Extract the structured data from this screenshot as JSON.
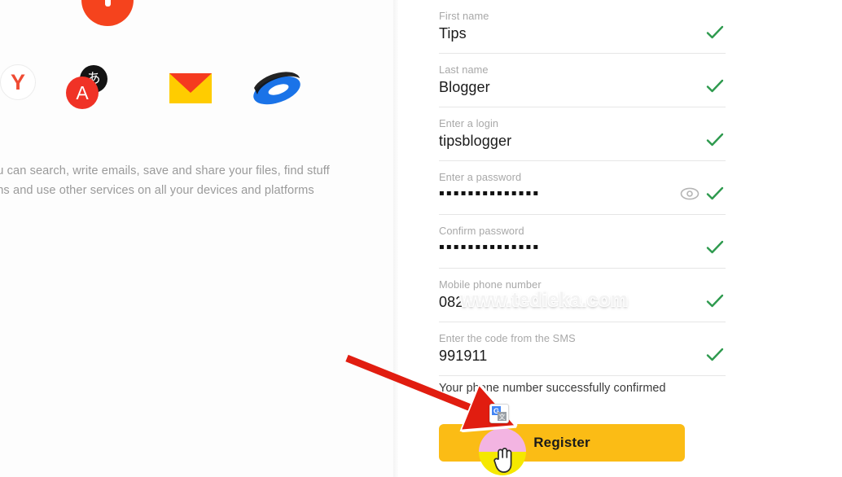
{
  "left_panel": {
    "service_icons": [
      {
        "name": "yandex-browser-icon",
        "glyph": "Y",
        "color": "#ef4b33"
      },
      {
        "name": "yandex-music-icon",
        "glyph": "",
        "color": "#f5431d"
      },
      {
        "name": "yandex-translate-icon",
        "glyph": "A",
        "glyph_secondary": "あ",
        "color": "#f03226"
      },
      {
        "name": "yandex-mail-icon",
        "glyph": "",
        "color": "#ffcc00"
      },
      {
        "name": "yandex-disk-icon",
        "glyph": "",
        "color": "#1a73e8"
      }
    ],
    "promo_line_1": "ou can search, write emails, save and share your files, find stuff",
    "promo_line_2": "ons and use other services on all your devices and platforms"
  },
  "form": {
    "fields": [
      {
        "label": "First name",
        "value": "Tips",
        "masked": false,
        "valid": true,
        "has_eye": false
      },
      {
        "label": "Last name",
        "value": "Blogger",
        "masked": false,
        "valid": true,
        "has_eye": false
      },
      {
        "label": "Enter a login",
        "value": "tipsblogger",
        "masked": false,
        "valid": true,
        "has_eye": false
      },
      {
        "label": "Enter a password",
        "value": "▪▪▪▪▪▪▪▪▪▪▪▪▪▪",
        "masked": true,
        "valid": true,
        "has_eye": true
      },
      {
        "label": "Confirm password",
        "value": "▪▪▪▪▪▪▪▪▪▪▪▪▪▪",
        "masked": true,
        "valid": true,
        "has_eye": false
      },
      {
        "label": "Mobile phone number",
        "value": "082",
        "masked": false,
        "valid": true,
        "has_eye": false
      },
      {
        "label": "Enter the code from the SMS",
        "value": "991911",
        "masked": false,
        "valid": true,
        "has_eye": false
      }
    ],
    "success_message": "Your phone number successfully confirmed",
    "register_label": "Register"
  },
  "overlay": {
    "watermark": "www.tedieka.com",
    "translate_badge_name": "google-translate-icon"
  },
  "colors": {
    "button": "#fbbc15",
    "check": "#2e9a4e",
    "arrow": "#e11d10",
    "label": "#a8a8a8"
  }
}
